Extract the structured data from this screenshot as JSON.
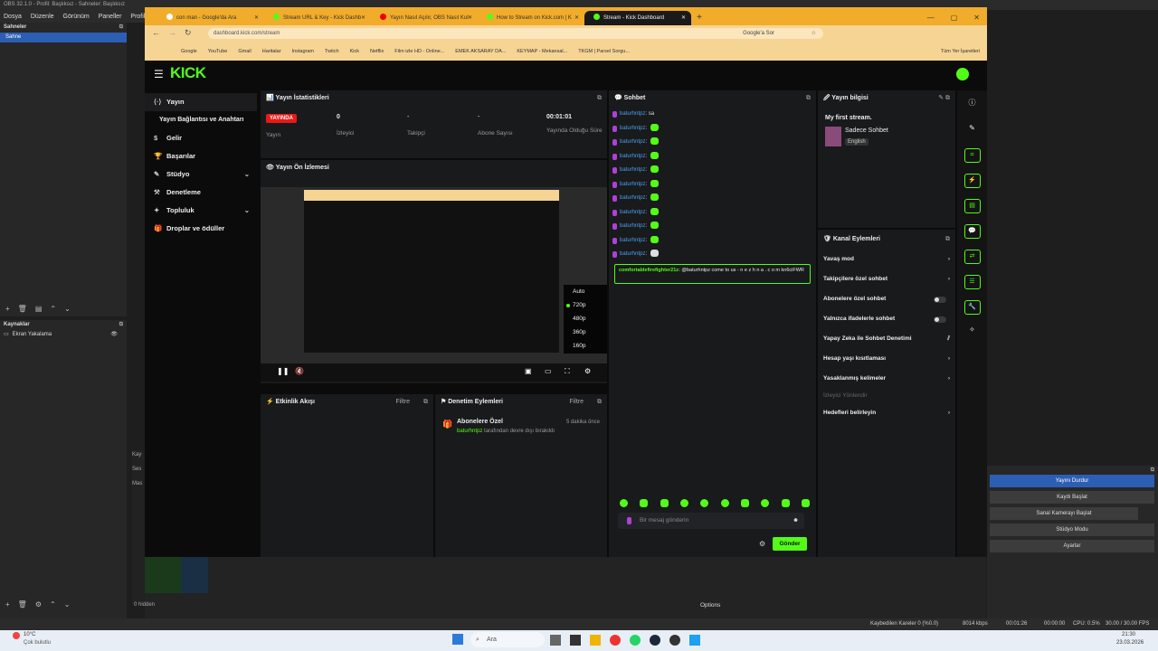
{
  "obs": {
    "title": "OBS 32.1.0 - Profil: Başlıksız - Sahneler: Başlıksız",
    "menu": [
      "Dosya",
      "Düzenle",
      "Görünüm",
      "Paneller",
      "Profil"
    ],
    "scenes_header": "Sahneler",
    "scene_selected": "Sahne",
    "sources_header": "Kaynaklar",
    "source_item": "Ekran Yakalama",
    "hidden_label": "0 hidden",
    "options_label": "Options",
    "mixer_label": "Kay",
    "mixer_label2": "Ses",
    "mixer_label3": "Mas",
    "controls": [
      "Yayını Durdur",
      "Kaydı Başlat",
      "Sanal Kamerayı Başlat",
      "Stüdyo Modu",
      "Ayarlar"
    ],
    "status": {
      "dropped": "Kaybedilen Kareler 0 (%0.0)",
      "bitrate": "8014 kbps",
      "stream_time": "00:01:26",
      "rec_time": "00:00:00",
      "cpu": "CPU: 0.5%",
      "fps": "30.00 / 30.00 FPS"
    }
  },
  "browser": {
    "tabs": [
      "con man - Google'da Ara",
      "Stream URL & Key - Kick Dashb",
      "Yayın Nasıl Açılır, OBS Nasıl Kul",
      "How to Stream on Kick.com | K",
      "Stream - Kick Dashboard"
    ],
    "url": "dashboard.kick.com/stream",
    "search_chip": "Google'a Sor",
    "bookmarks": [
      "Google",
      "YouTube",
      "Gmail",
      "Haritalar",
      "Instagram",
      "Twitch",
      "Kick",
      "Netflix",
      "Film izle HD - Online...",
      "EMEK AKSARAY DA...",
      "KEYMAP - Mekansal...",
      "TKGM | Parsel Sorgu..."
    ],
    "all_bookmarks": "Tüm Yer İşaretleri"
  },
  "kick": {
    "logo": "KICK",
    "nav": [
      "Yayın",
      "Yayın Bağlantısı ve Anahtarı",
      "Gelir",
      "Başarılar",
      "Stüdyo",
      "Denetleme",
      "Topluluk",
      "Droplar ve ödüller"
    ],
    "stats_title": "Yayın İstatistikleri",
    "stats": [
      {
        "value": "YAYINDA",
        "label": "Yayın"
      },
      {
        "value": "0",
        "label": "İzleyici"
      },
      {
        "value": "-",
        "label": "Takipçi"
      },
      {
        "value": "-",
        "label": "Abone Sayısı"
      },
      {
        "value": "00:01:01",
        "label": "Yayında Olduğu Süre"
      }
    ],
    "preview_title": "Yayın Ön İzlemesi",
    "quality": [
      "Auto",
      "720p",
      "480p",
      "360p",
      "160p"
    ],
    "quality_selected": "720p",
    "activity_title": "Etkinlik Akışı",
    "filter": "Filtre",
    "mod_title": "Denetim Eylemleri",
    "mod_item_title": "Abonelere Özel",
    "mod_item_time": "5 dakika önce",
    "mod_item_user": "baturhntpz",
    "mod_item_text": "tarafından devre dışı bırakıldı",
    "chat_title": "Sohbet",
    "chat_user": "baturhntpz",
    "chat_first_msg": "sa",
    "chat_highlight_user": "comfortablefirefighter21z:",
    "chat_highlight_text": "@baturhntpz come to us - n e z h n a . c o m kn6ciFWR",
    "chat_placeholder": "Bir mesaj gönderin",
    "send": "Gönder",
    "info_title": "Yayın bilgisi",
    "stream_title": "My first stream.",
    "category": "Sadece Sohbet",
    "language": "English",
    "actions_title": "Kanal Eylemleri",
    "actions": [
      "Yavaş mod",
      "Takipçilere özel sohbet",
      "Abonelere özel sohbet",
      "Yalnızca ifadelerle sohbet",
      "Yapay Zeka ile Sohbet Denetimi",
      "Hesap yaşı kısıtlaması",
      "Yasaklanmış kelimeler"
    ],
    "actions_sub": "İzleyici Yönlendir",
    "targets": "Hedefleri belirleyin"
  },
  "taskbar": {
    "weather_temp": "10°C",
    "weather_text": "Çok bulutlu",
    "search": "Ara",
    "time": "21:30",
    "date": "23.03.2026"
  },
  "colors": {
    "kick_green": "#53fc18",
    "live_red": "#e91916",
    "obs_blue": "#2c5eb4"
  }
}
